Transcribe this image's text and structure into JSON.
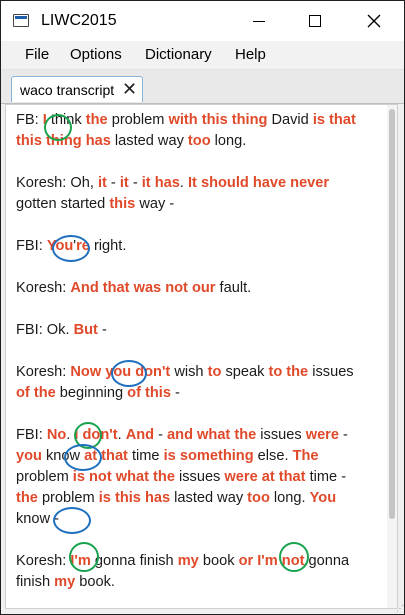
{
  "window": {
    "title": "LIWC2015",
    "icon": "app-icon"
  },
  "menu": {
    "items": [
      "File",
      "Options",
      "Dictionary",
      "Help"
    ]
  },
  "tab": {
    "label": "waco transcript",
    "close_glyph": "✕"
  },
  "colors": {
    "liwc_word": "#e04a2a",
    "circle_green": "#1aa34f",
    "circle_blue": "#1f6fbf"
  },
  "transcript": [
    [
      {
        "t": "FB"
      },
      {
        "t": ": "
      },
      {
        "t": "I",
        "h": 1
      },
      {
        "t": " think "
      },
      {
        "t": "the",
        "h": 1
      },
      {
        "t": " problem "
      },
      {
        "t": "with this thing",
        "h": 1
      },
      {
        "t": " David "
      },
      {
        "t": "is that this thing has",
        "h": 1
      },
      {
        "t": " lasted way "
      },
      {
        "t": "too",
        "h": 1
      },
      {
        "t": " long."
      }
    ],
    [
      {
        "t": "Koresh: Oh, "
      },
      {
        "t": "it",
        "h": 1
      },
      {
        "t": " - "
      },
      {
        "t": "it",
        "h": 1
      },
      {
        "t": " - "
      },
      {
        "t": "it has",
        "h": 1
      },
      {
        "t": ". "
      },
      {
        "t": "It should have never",
        "h": 1
      },
      {
        "t": " gotten started "
      },
      {
        "t": "this",
        "h": 1
      },
      {
        "t": " way -"
      }
    ],
    [
      {
        "t": "FBI: "
      },
      {
        "t": "You",
        "h": 1
      },
      {
        "t": "'"
      },
      {
        "t": "re",
        "h": 1
      },
      {
        "t": " right."
      }
    ],
    [
      {
        "t": "Koresh: "
      },
      {
        "t": "And that was not our",
        "h": 1
      },
      {
        "t": " fault."
      }
    ],
    [
      {
        "t": "FBI: Ok. "
      },
      {
        "t": "But",
        "h": 1
      },
      {
        "t": " -"
      }
    ],
    [
      {
        "t": "Koresh: "
      },
      {
        "t": "Now you don't",
        "h": 1
      },
      {
        "t": " wish "
      },
      {
        "t": "to",
        "h": 1
      },
      {
        "t": " speak "
      },
      {
        "t": "to the",
        "h": 1
      },
      {
        "t": " issues "
      },
      {
        "t": "of the",
        "h": 1
      },
      {
        "t": " beginning "
      },
      {
        "t": "of this",
        "h": 1
      },
      {
        "t": " -"
      }
    ],
    [
      {
        "t": "FBI: "
      },
      {
        "t": "No",
        "h": 1
      },
      {
        "t": ". "
      },
      {
        "t": "I don't",
        "h": 1
      },
      {
        "t": ". "
      },
      {
        "t": "And",
        "h": 1
      },
      {
        "t": " - "
      },
      {
        "t": "and what the",
        "h": 1
      },
      {
        "t": " issues "
      },
      {
        "t": "were",
        "h": 1
      },
      {
        "t": " - "
      },
      {
        "t": "you",
        "h": 1
      },
      {
        "t": " know "
      },
      {
        "t": "at that",
        "h": 1
      },
      {
        "t": " time "
      },
      {
        "t": "is something",
        "h": 1
      },
      {
        "t": " else. "
      },
      {
        "t": "The",
        "h": 1
      },
      {
        "t": " problem "
      },
      {
        "t": "is not what the",
        "h": 1
      },
      {
        "t": " issues "
      },
      {
        "t": "were at that",
        "h": 1
      },
      {
        "t": " time - "
      },
      {
        "t": "the",
        "h": 1
      },
      {
        "t": " problem "
      },
      {
        "t": "is this has",
        "h": 1
      },
      {
        "t": " lasted way "
      },
      {
        "t": "too",
        "h": 1
      },
      {
        "t": " long. "
      },
      {
        "t": "You",
        "h": 1
      },
      {
        "t": " know -"
      }
    ],
    [
      {
        "t": "Koresh: "
      },
      {
        "t": "I'm",
        "h": 1
      },
      {
        "t": " gonna finish "
      },
      {
        "t": "my",
        "h": 1
      },
      {
        "t": " book "
      },
      {
        "t": "or",
        "h": 1
      },
      {
        "t": " "
      },
      {
        "t": "I'm",
        "h": 1
      },
      {
        "t": " "
      },
      {
        "t": "not",
        "h": 1
      },
      {
        "t": " gonna finish "
      },
      {
        "t": "my",
        "h": 1
      },
      {
        "t": " book."
      }
    ]
  ],
  "annotations": [
    {
      "word": "I",
      "color": "green"
    },
    {
      "word": "You",
      "color": "blue"
    },
    {
      "word": "you",
      "color": "blue"
    },
    {
      "word": "I",
      "color": "green"
    },
    {
      "word": "you",
      "color": "blue"
    },
    {
      "word": "You",
      "color": "blue"
    },
    {
      "word": "I'm",
      "color": "green"
    },
    {
      "word": "I'm",
      "color": "green"
    }
  ]
}
